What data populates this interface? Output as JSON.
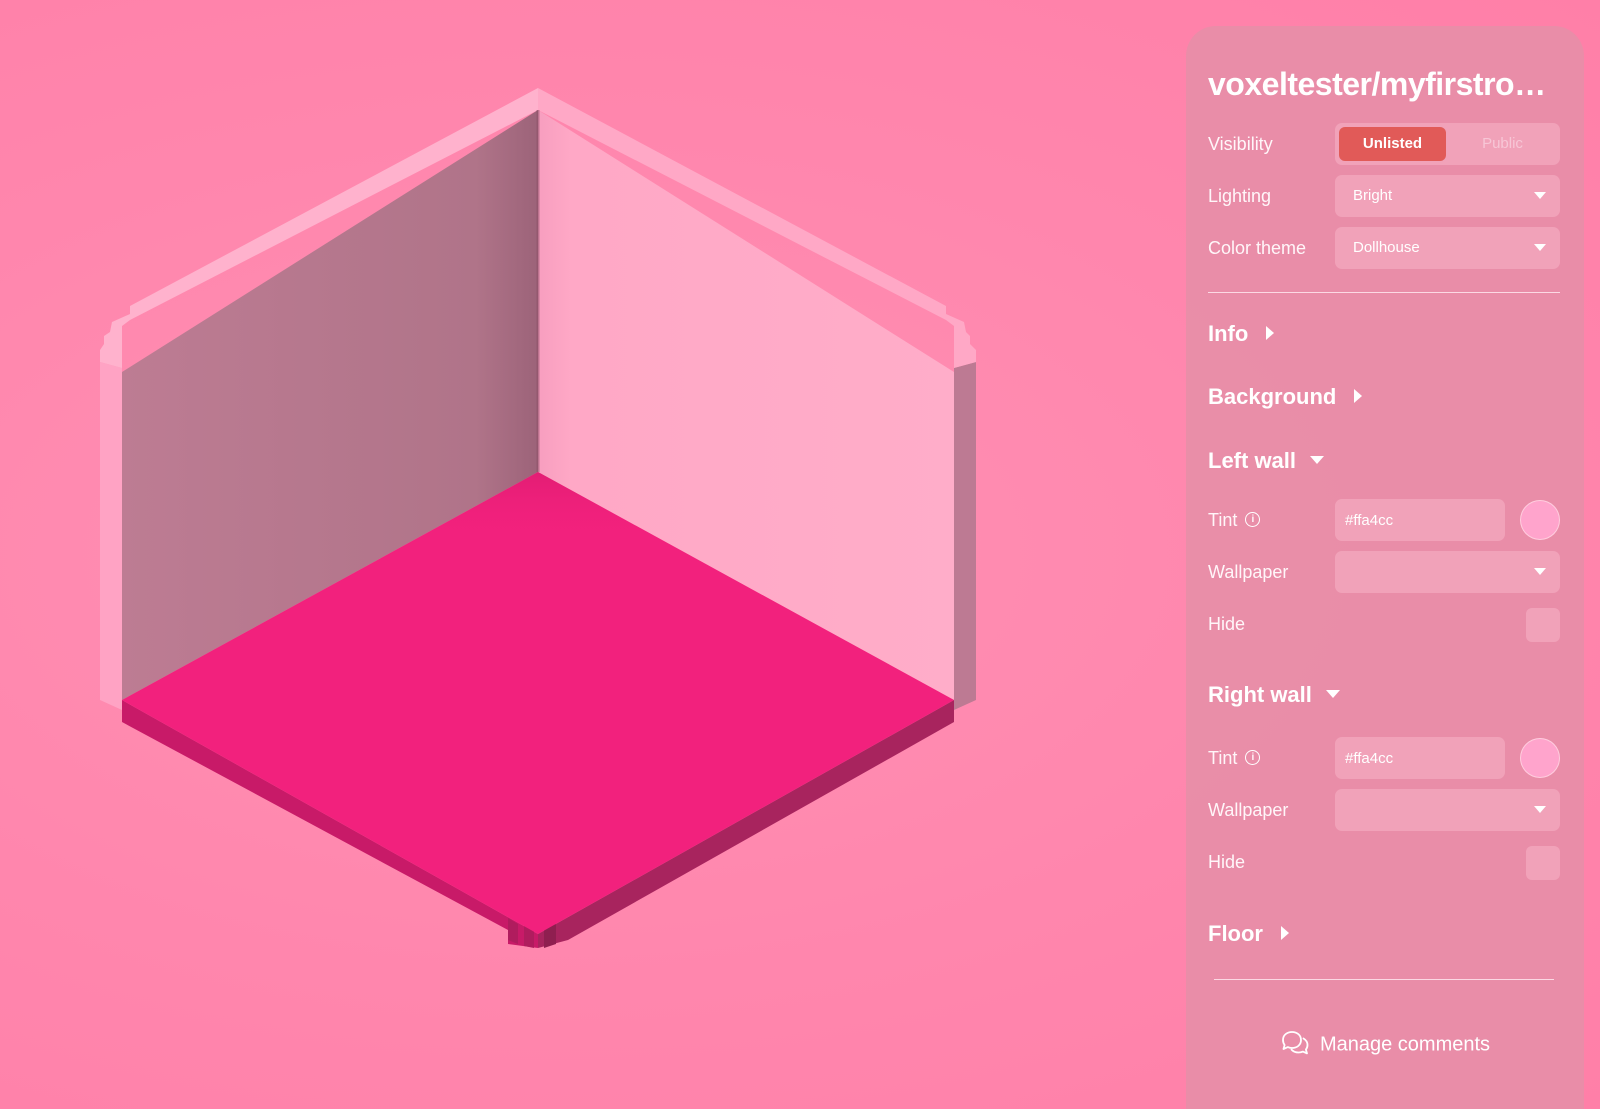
{
  "room": {
    "title": "voxeltester/myfirstroom",
    "colors": {
      "left_wall": "#b07489",
      "right_wall": "#ffa8c6",
      "floor": "#f2217d",
      "floor_edge_left": "#c81a68",
      "floor_edge_right": "#a8245e",
      "wall_top": "#ffb0cc"
    }
  },
  "panel": {
    "visibility": {
      "label": "Visibility",
      "options": [
        "Unlisted",
        "Public"
      ],
      "selected": "Unlisted"
    },
    "lighting": {
      "label": "Lighting",
      "value": "Bright"
    },
    "color_theme": {
      "label": "Color theme",
      "value": "Dollhouse"
    },
    "sections": {
      "info": {
        "label": "Info",
        "expanded": false
      },
      "background": {
        "label": "Background",
        "expanded": false
      },
      "left_wall": {
        "label": "Left wall",
        "expanded": true,
        "tint_label": "Tint",
        "tint_value": "#ffa4cc",
        "wallpaper_label": "Wallpaper",
        "wallpaper_value": "",
        "hide_label": "Hide",
        "hidden": false
      },
      "right_wall": {
        "label": "Right wall",
        "expanded": true,
        "tint_label": "Tint",
        "tint_value": "#ffa4cc",
        "wallpaper_label": "Wallpaper",
        "wallpaper_value": "",
        "hide_label": "Hide",
        "hidden": false
      },
      "floor": {
        "label": "Floor",
        "expanded": false
      }
    },
    "manage_comments_label": "Manage comments",
    "accent_color": "#e15a58"
  }
}
